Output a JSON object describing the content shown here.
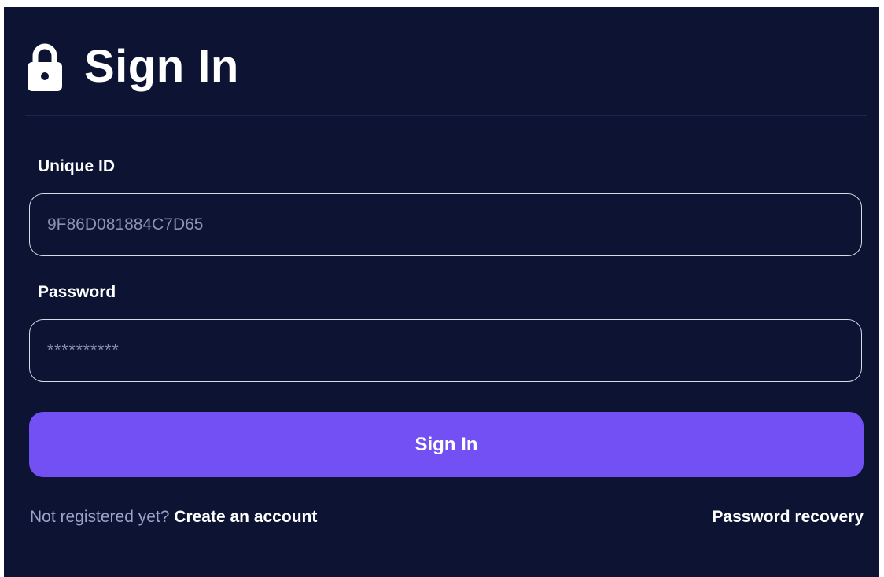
{
  "header": {
    "title": "Sign In",
    "icon": "lock-icon"
  },
  "form": {
    "unique_id": {
      "label": "Unique ID",
      "placeholder": "9F86D081884C7D65"
    },
    "password": {
      "label": "Password",
      "placeholder": "**********"
    },
    "submit_label": "Sign In"
  },
  "footer": {
    "prompt": "Not registered yet?",
    "create_account": "Create an account",
    "password_recovery": "Password recovery"
  },
  "colors": {
    "background": "#0c1333",
    "accent": "#7350f3",
    "muted_text": "#9ea3c5"
  }
}
